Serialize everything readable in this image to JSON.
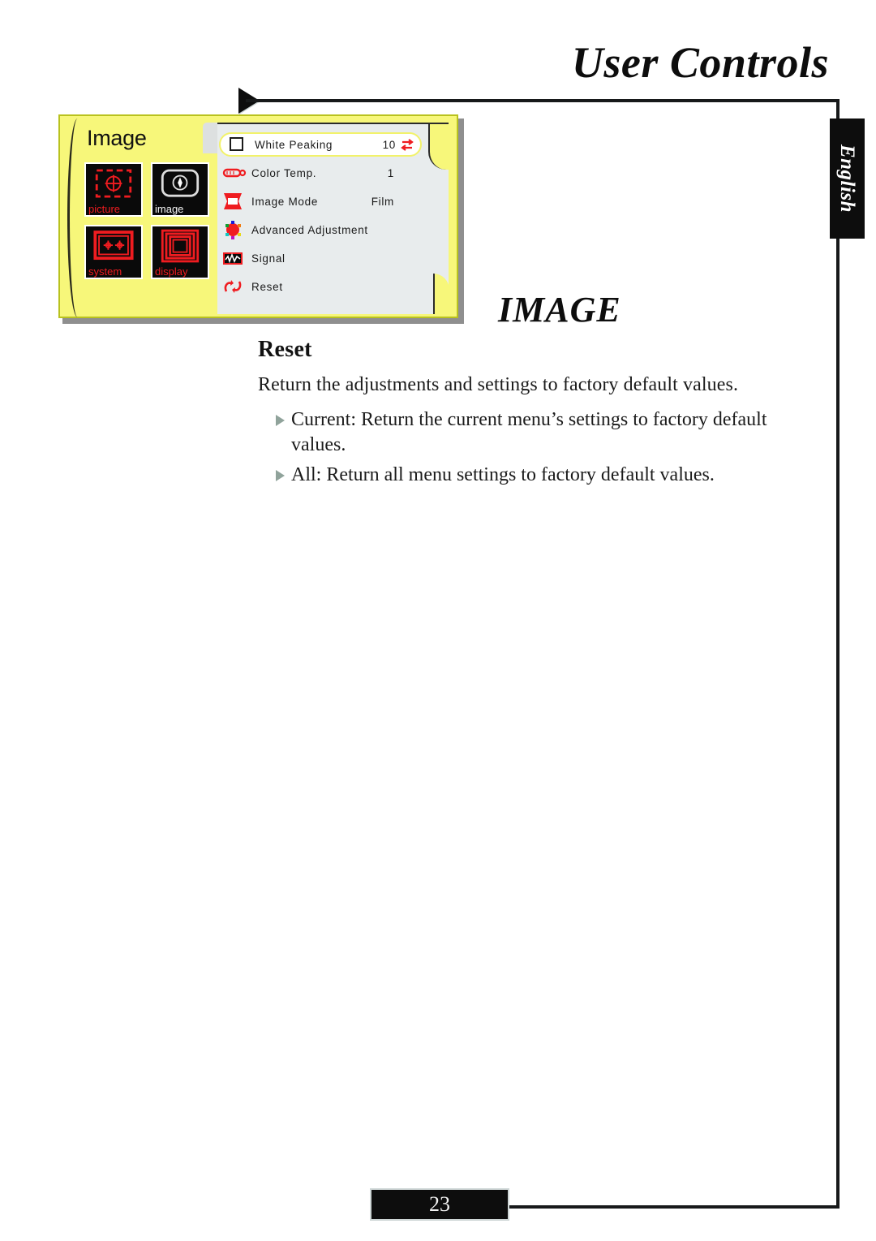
{
  "document": {
    "chapter_title": "User Controls",
    "language_tab": "English",
    "section_heading": "IMAGE",
    "page_number": "23"
  },
  "content": {
    "subheading": "Reset",
    "intro": "Return the adjustments and settings to factory default values.",
    "bullets": [
      "Current: Return the current menu’s settings to factory default values.",
      "All: Return all menu settings to factory default values."
    ]
  },
  "osd": {
    "menu_title": "Image",
    "categories": [
      {
        "label": "picture",
        "icon": "picture-icon",
        "active": false
      },
      {
        "label": "image",
        "icon": "image-icon",
        "active": true
      },
      {
        "label": "system",
        "icon": "system-icon",
        "active": false
      },
      {
        "label": "display",
        "icon": "display-icon",
        "active": false
      }
    ],
    "rows": [
      {
        "label": "White Peaking",
        "value": "10",
        "icon": "checkbox-icon",
        "selected": true,
        "adjust": "left-right-arrows-icon"
      },
      {
        "label": "Color Temp.",
        "value": "1",
        "icon": "color-temp-icon",
        "selected": false,
        "adjust": ""
      },
      {
        "label": "Image Mode",
        "value": "Film",
        "icon": "image-mode-icon",
        "selected": false,
        "adjust": ""
      },
      {
        "label": "Advanced Adjustment",
        "value": "",
        "icon": "advanced-adjustment-icon",
        "selected": false,
        "adjust": ""
      },
      {
        "label": "Signal",
        "value": "",
        "icon": "signal-icon",
        "selected": false,
        "adjust": ""
      },
      {
        "label": "Reset",
        "value": "",
        "icon": "reset-icon",
        "selected": false,
        "adjust": ""
      }
    ]
  },
  "colors": {
    "osd_yellow": "#f7f77a",
    "osd_gray": "#e8eced",
    "osd_red": "#ef1c20",
    "ink": "#0d0d0d",
    "bullet_gray": "#90a39b"
  }
}
